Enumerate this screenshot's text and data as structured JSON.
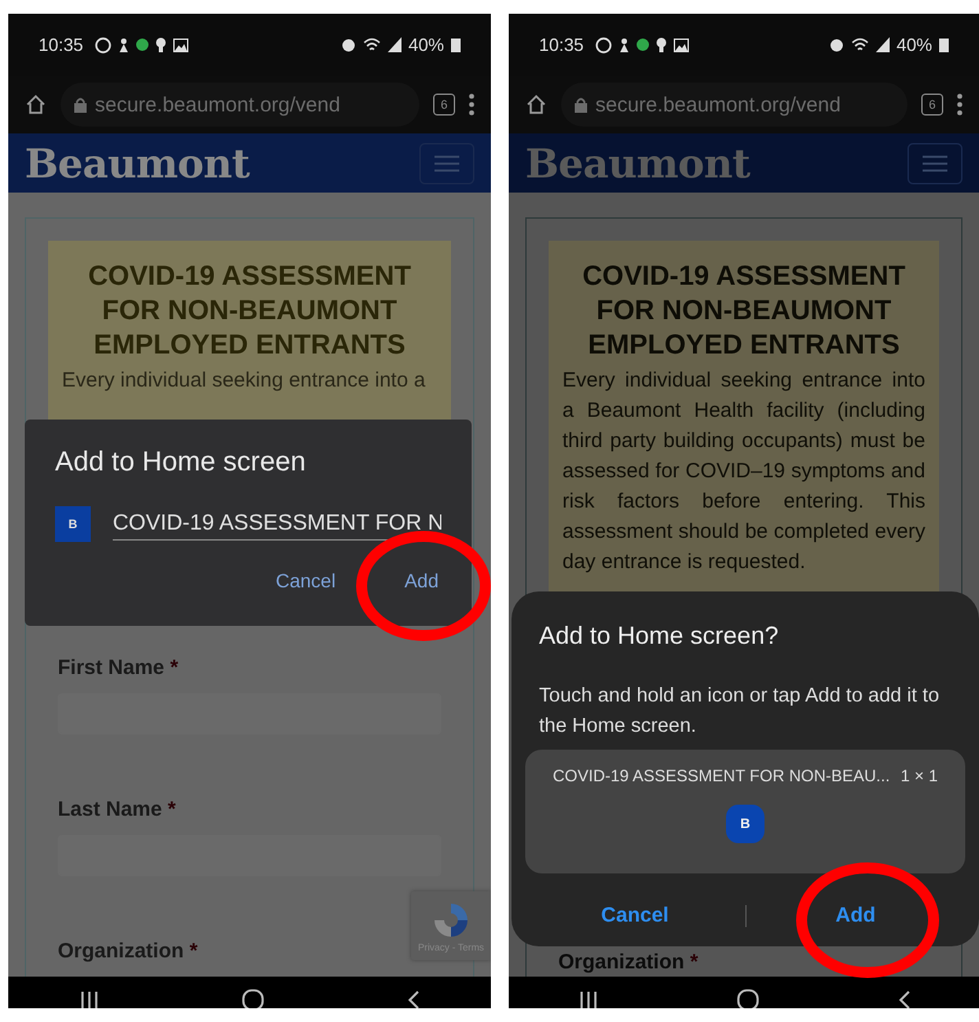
{
  "phones": [
    {
      "kind": "dim",
      "status_bar": {
        "time": "10:35",
        "battery": "40%"
      },
      "browser": {
        "url": "secure.beaumont.org/vend",
        "tab_count": "6"
      },
      "site": {
        "logo": "Beaumont"
      },
      "notice": {
        "title": "COVID-19 ASSESSMENT FOR NON-BEAUMONT EMPLOYED ENTRANTS",
        "body": "Every individual seeking entrance into a",
        "covered": true
      },
      "form": {
        "fields": [
          {
            "label": "First Name",
            "required_mark": "*"
          },
          {
            "label": "Last Name",
            "required_mark": "*"
          },
          {
            "label": "Organization",
            "required_mark": "*"
          }
        ]
      },
      "recaptcha": {
        "links": "Privacy - Terms"
      },
      "dialog": {
        "kind": "rename",
        "title": "Add to Home screen",
        "icon_letter": "B",
        "value": "COVID-19 ASSESSMENT FOR N",
        "buttons": [
          {
            "label": "Cancel"
          },
          {
            "label": "Add"
          }
        ]
      }
    },
    {
      "kind": "darker",
      "status_bar": {
        "time": "10:35",
        "battery": "40%"
      },
      "browser": {
        "url": "secure.beaumont.org/vend",
        "tab_count": "6"
      },
      "site": {
        "logo": "Beaumont"
      },
      "notice": {
        "title": "COVID-19 ASSESSMENT FOR NON-BEAUMONT EMPLOYED ENTRANTS",
        "body": "Every individual seeking entrance into a Beaumont Health facility (including third party building occupants) must be assessed for COVID–19 symptoms and risk factors before entering. This assessment should be completed every day entrance is requested.",
        "covered": false
      },
      "form": {
        "fields": [
          {
            "label": "Organization",
            "required_mark": "*"
          }
        ]
      },
      "dialog": {
        "kind": "preview",
        "title": "Add to Home screen?",
        "message": "Touch and hold an icon or tap Add to add it to the Home screen.",
        "widget_name": "COVID-19 ASSESSMENT FOR NON-BEAU...",
        "widget_size": "1 × 1",
        "icon_letter": "B",
        "buttons": [
          {
            "label": "Cancel"
          },
          {
            "label": "Add"
          }
        ]
      }
    }
  ]
}
